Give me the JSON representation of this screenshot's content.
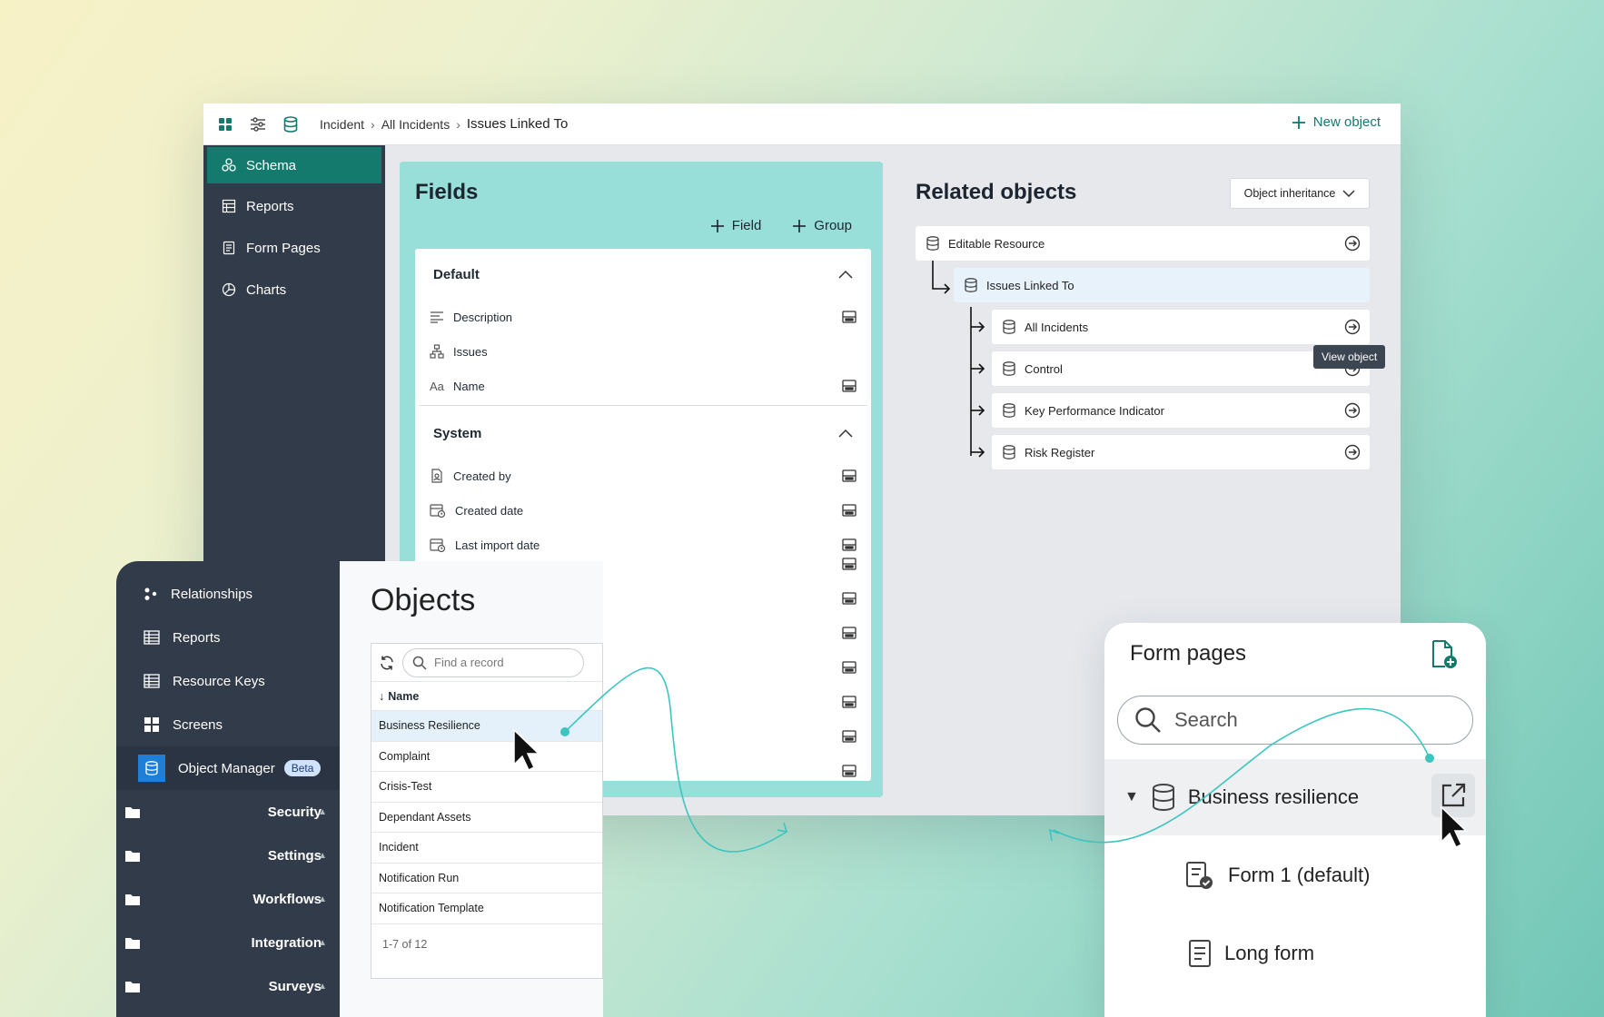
{
  "topbar": {
    "breadcrumb": [
      "Incident",
      "All Incidents",
      "Issues Linked To"
    ],
    "new_object_label": "New object"
  },
  "sidenav": {
    "items": [
      {
        "label": "Schema",
        "icon": "schema-icon",
        "active": true
      },
      {
        "label": "Reports",
        "icon": "table-icon"
      },
      {
        "label": "Form Pages",
        "icon": "form-icon"
      },
      {
        "label": "Charts",
        "icon": "pie-chart-icon"
      }
    ]
  },
  "fields": {
    "title": "Fields",
    "add_field_label": "Field",
    "add_group_label": "Group",
    "groups": [
      {
        "name": "Default",
        "rows": [
          "Description",
          "Issues",
          "Name"
        ]
      },
      {
        "name": "System",
        "rows": [
          "Created by",
          "Created date",
          "Last import date"
        ]
      }
    ]
  },
  "related": {
    "title": "Related objects",
    "inheritance_label": "Object inheritance",
    "root": "Editable Resource",
    "current": "Issues Linked To",
    "children": [
      "All Incidents",
      "Control",
      "Key Performance Indicator",
      "Risk Register"
    ],
    "tooltip": "View object"
  },
  "left_nav": {
    "items": [
      {
        "label": "Relationships",
        "type": "sub",
        "icon": "relationships-icon"
      },
      {
        "label": "Reports",
        "type": "sub",
        "icon": "table-icon"
      },
      {
        "label": "Resource Keys",
        "type": "sub",
        "icon": "table-icon"
      },
      {
        "label": "Screens",
        "type": "sub",
        "icon": "grid-icon"
      },
      {
        "label": "Object Manager",
        "type": "sub",
        "icon": "database-icon",
        "badge": "Beta",
        "active": true
      },
      {
        "label": "Security",
        "type": "group",
        "icon": "folder-icon"
      },
      {
        "label": "Settings",
        "type": "group",
        "icon": "folder-icon"
      },
      {
        "label": "Workflows",
        "type": "group",
        "icon": "folder-icon"
      },
      {
        "label": "Integration",
        "type": "group",
        "icon": "folder-icon"
      },
      {
        "label": "Surveys",
        "type": "group",
        "icon": "folder-icon"
      }
    ]
  },
  "objects": {
    "title": "Objects",
    "search_placeholder": "Find a record",
    "column": "Name",
    "rows": [
      "Business Resilience",
      "Complaint",
      "Crisis-Test",
      "Dependant Assets",
      "Incident",
      "Notification Run",
      "Notification Template"
    ],
    "pagination": "1-7 of 12"
  },
  "form_pages": {
    "title": "Form pages",
    "search_placeholder": "Search",
    "object": "Business resilience",
    "forms": [
      "Form 1 (default)",
      "Long form"
    ]
  },
  "colors": {
    "accent": "#147a6e",
    "nav_bg": "#323b49",
    "fields_bg": "#98dfd9",
    "connector": "#3cc5c0"
  }
}
